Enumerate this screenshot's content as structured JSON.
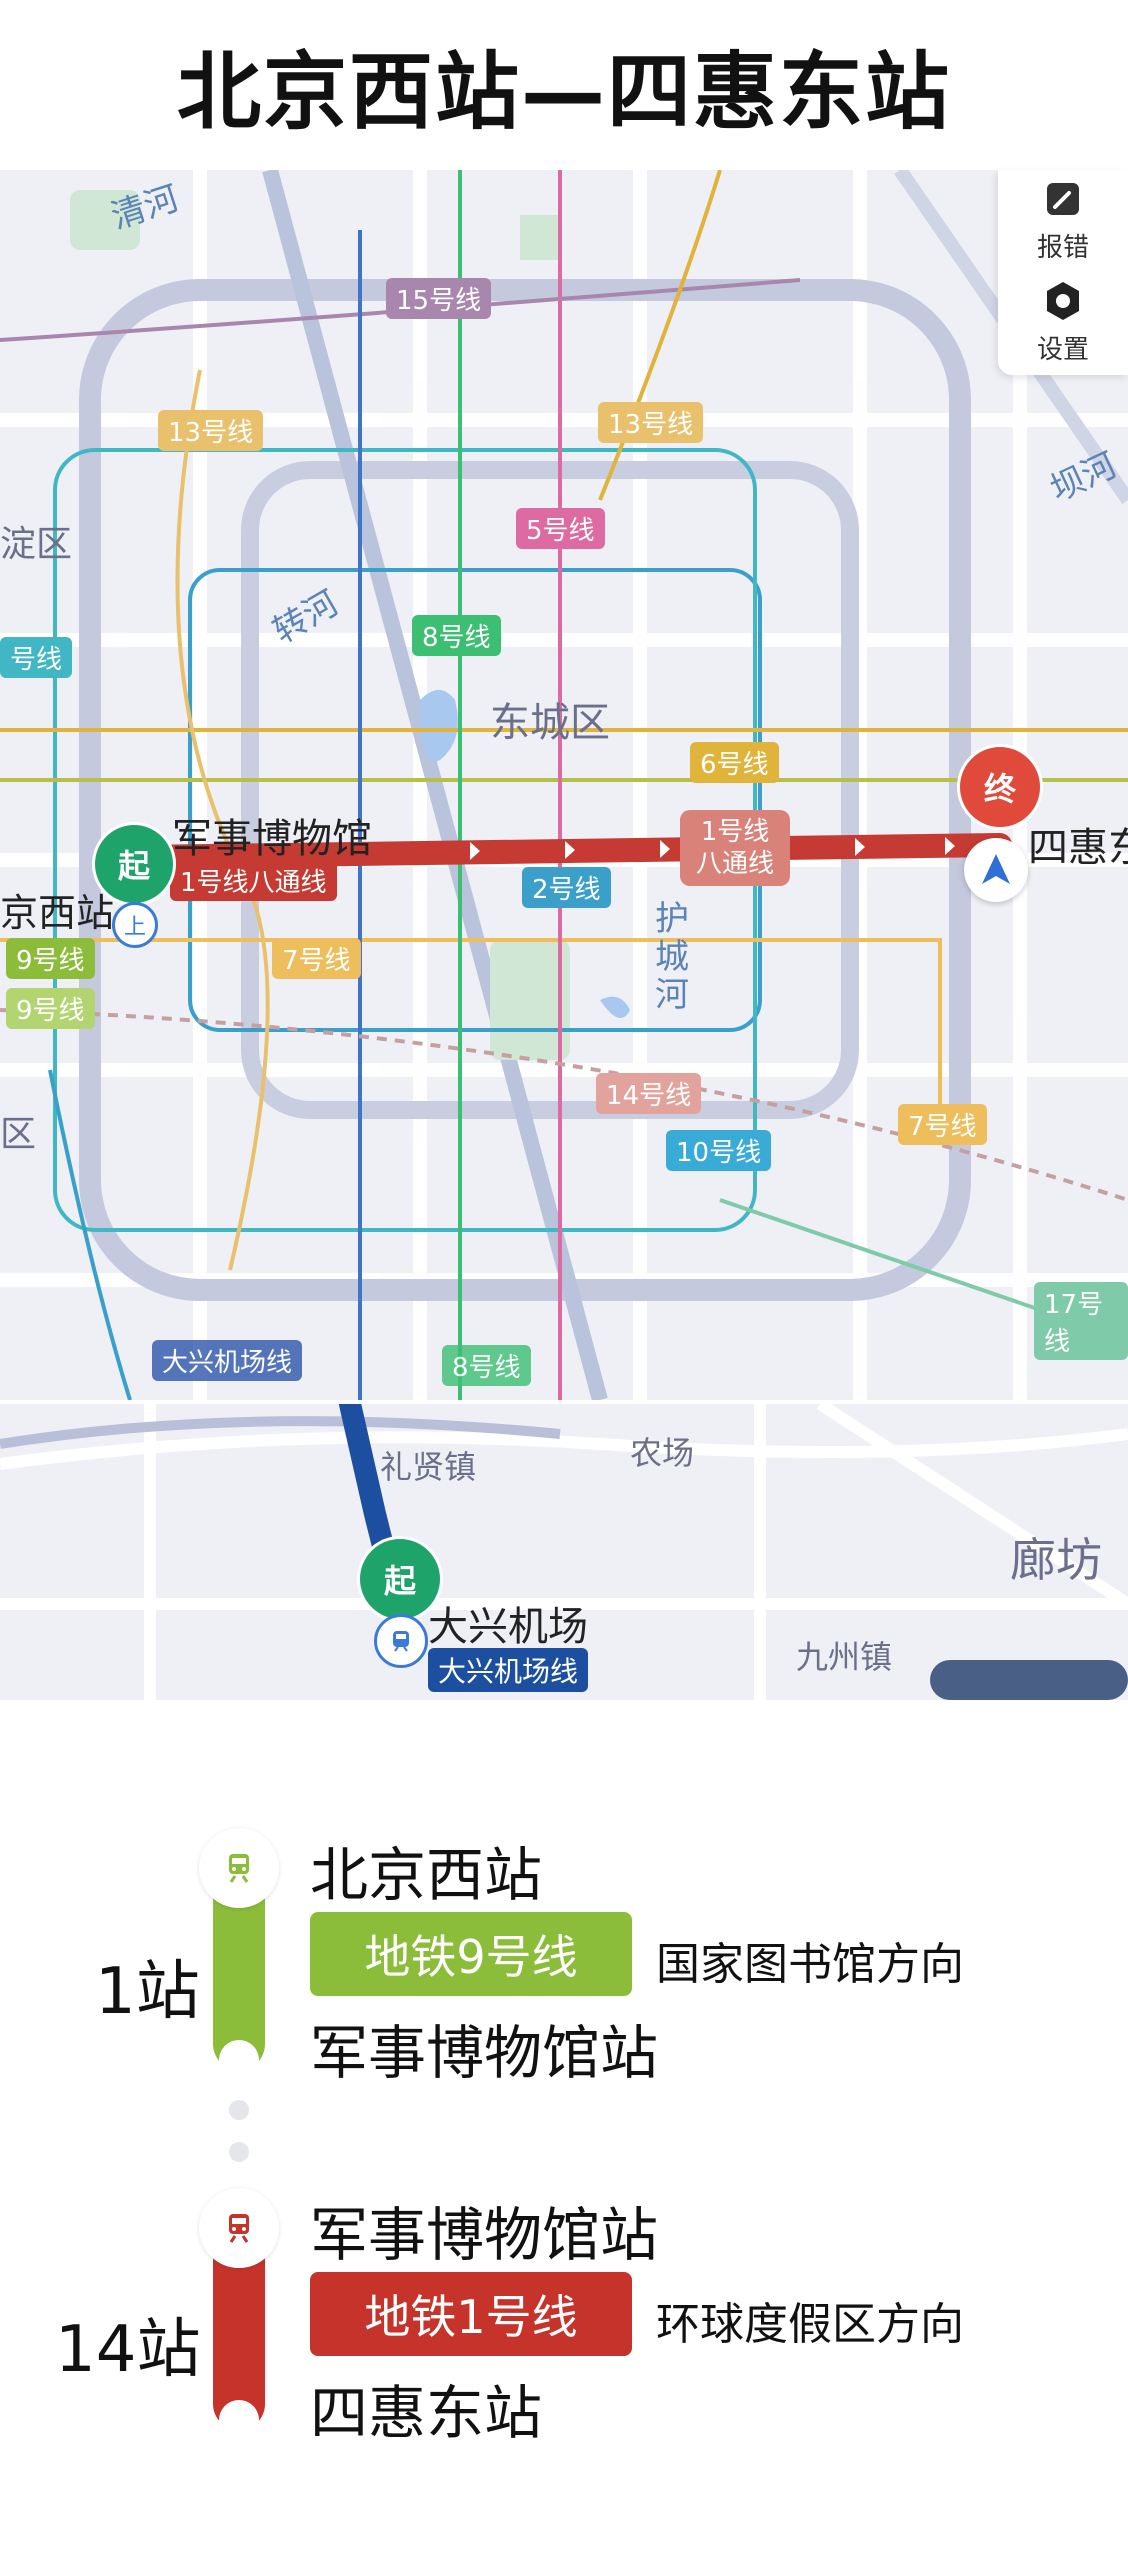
{
  "header": {
    "title": "北京西站—四惠东站"
  },
  "toolbar": {
    "report_label": "报错",
    "settings_label": "设置"
  },
  "map": {
    "districts": [
      "东城区",
      "淀区",
      "区"
    ],
    "rivers": [
      "清河",
      "坝河",
      "转河",
      "护城河"
    ],
    "line_labels": [
      "15号线",
      "13号线",
      "13号线",
      "5号线",
      "号线",
      "8号线",
      "6号线",
      "2号线",
      "9号线",
      "9号线",
      "7号线",
      "14号线",
      "10号线",
      "7号线",
      "17号线",
      "大兴机场线",
      "8号线"
    ],
    "route_pill_top": "1号线",
    "route_pill_bottom": "八通线",
    "start_tag_line": "1号线八通线",
    "start_station": "军事博物馆",
    "start_left_station": "京西站",
    "end_station": "四惠东",
    "start_badge": "起",
    "end_badge": "终",
    "transfer_badge": "上"
  },
  "map2": {
    "places": [
      "礼贤镇",
      "农场",
      "九州镇",
      "廊坊"
    ],
    "start_badge": "起",
    "station": "大兴机场",
    "line_tag": "大兴机场线"
  },
  "segments": [
    {
      "from": "北京西站",
      "line": "地铁9号线",
      "direction": "国家图书馆方向",
      "to": "军事博物馆站",
      "stops": "1站",
      "color": "#8cbd3a"
    },
    {
      "from": "军事博物馆站",
      "line": "地铁1号线",
      "direction": "环球度假区方向",
      "to": "四惠东站",
      "stops": "14站",
      "color": "#c6332b"
    }
  ]
}
